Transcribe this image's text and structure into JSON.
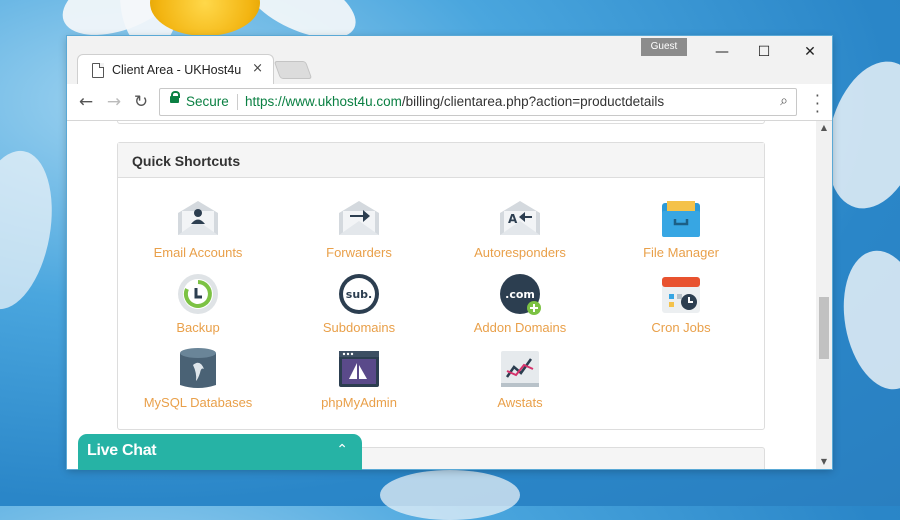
{
  "browser": {
    "guest_label": "Guest",
    "tab_title": "Client Area - UKHost4u",
    "tab_close": "×",
    "secure_label": "Secure",
    "url_scheme": "https://",
    "url_host": "www.ukhost4u.com",
    "url_path": "/billing/clientarea.php?action=productdetails",
    "window_controls": {
      "minimize": "—",
      "maximize": "☐",
      "close": "✕"
    }
  },
  "panel": {
    "title": "Quick Shortcuts",
    "shortcuts": [
      {
        "label": "Email Accounts",
        "icon": "email-accounts-icon"
      },
      {
        "label": "Forwarders",
        "icon": "forwarders-icon"
      },
      {
        "label": "Autoresponders",
        "icon": "autoresponders-icon"
      },
      {
        "label": "File Manager",
        "icon": "file-manager-icon"
      },
      {
        "label": "Backup",
        "icon": "backup-icon"
      },
      {
        "label": "Subdomains",
        "icon": "subdomains-icon"
      },
      {
        "label": "Addon Domains",
        "icon": "addon-domains-icon"
      },
      {
        "label": "Cron Jobs",
        "icon": "cron-jobs-icon"
      },
      {
        "label": "MySQL Databases",
        "icon": "mysql-databases-icon"
      },
      {
        "label": "phpMyAdmin",
        "icon": "phpmyadmin-icon"
      },
      {
        "label": "Awstats",
        "icon": "awstats-icon"
      }
    ]
  },
  "icon_text": {
    "subdomains": "sub.",
    "addon": ".com",
    "autoresponder": "A"
  },
  "livechat": {
    "title": "Live Chat",
    "toggle": "⌃"
  },
  "colors": {
    "label": "#e9a04a",
    "accent": "#26b3a5",
    "secure": "#0b8043"
  }
}
